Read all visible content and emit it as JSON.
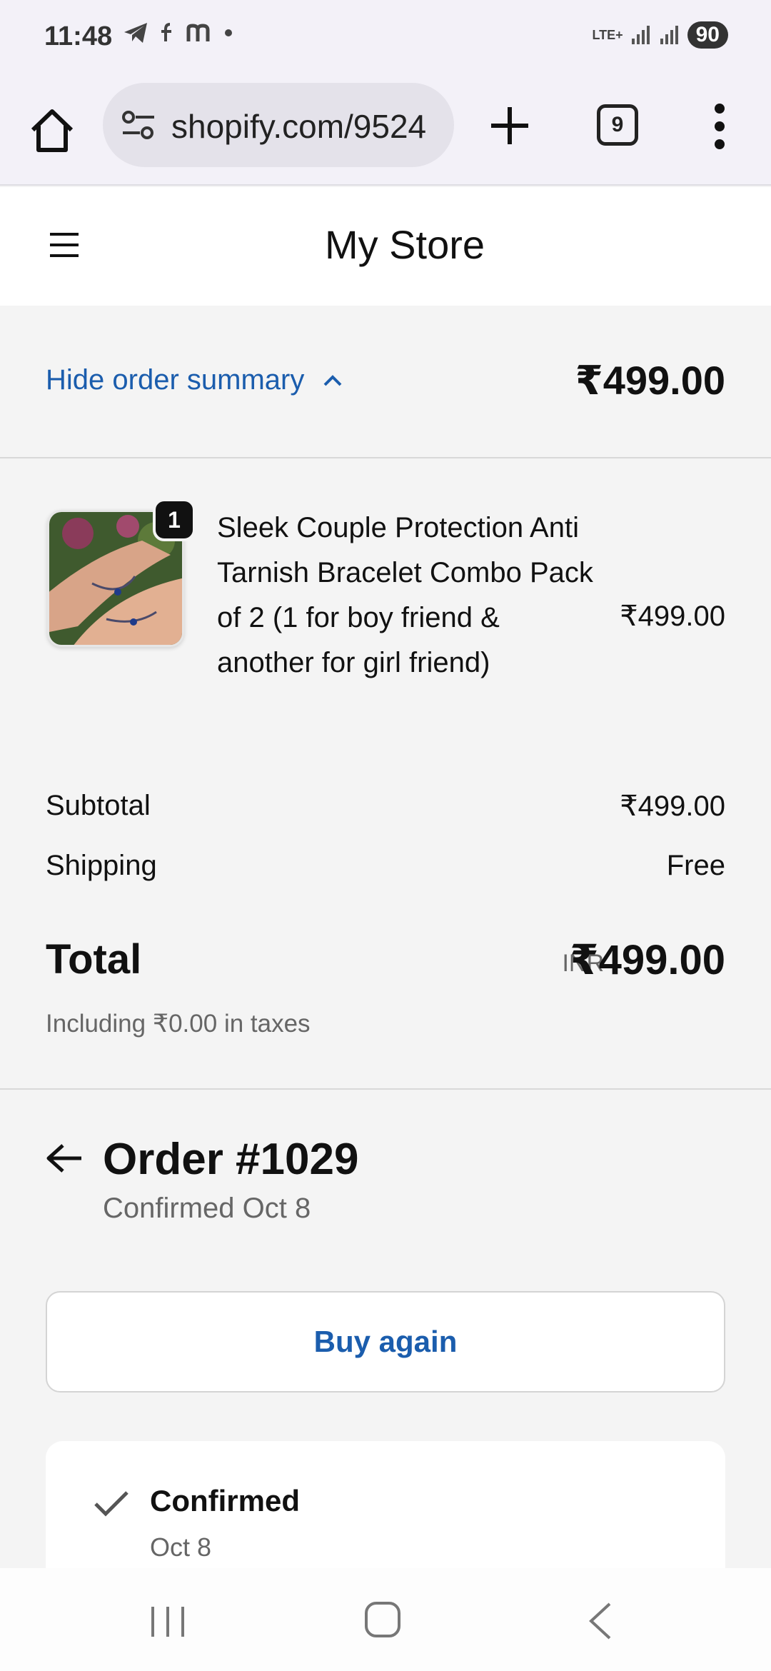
{
  "status_bar": {
    "time": "11:48",
    "network": "LTE+",
    "battery": "90",
    "icons": [
      "telegram-icon",
      "f-icon",
      "m-icon",
      "dot-icon",
      "signal-icon",
      "signal-icon"
    ]
  },
  "browser": {
    "url": "shopify.com/9524",
    "tab_count": "9",
    "icons": [
      "home-icon",
      "site-settings-icon",
      "plus-icon",
      "tabs-icon",
      "more-vert-icon"
    ]
  },
  "store": {
    "title": "My Store"
  },
  "summary": {
    "toggle_label": "Hide order summary",
    "toggle_total": "₹499.00"
  },
  "product": {
    "quantity": "1",
    "name": "Sleek Couple Protection Anti Tarnish Bracelet Combo Pack of 2 (1 for boy friend & another for girl friend)",
    "price": "₹499.00"
  },
  "totals": {
    "subtotal_label": "Subtotal",
    "subtotal_value": "₹499.00",
    "shipping_label": "Shipping",
    "shipping_value": "Free",
    "total_label": "Total",
    "currency": "INR",
    "total_value": "₹499.00",
    "taxes_note": "Including ₹0.00 in taxes"
  },
  "order": {
    "title": "Order #1029",
    "subtitle": "Confirmed Oct 8",
    "buy_again_label": "Buy again",
    "status_title": "Confirmed",
    "status_date": "Oct 8"
  },
  "colors": {
    "link_blue": "#1b5dad",
    "page_bg": "#f4f4f4",
    "browser_bg": "#f3f1f8"
  }
}
